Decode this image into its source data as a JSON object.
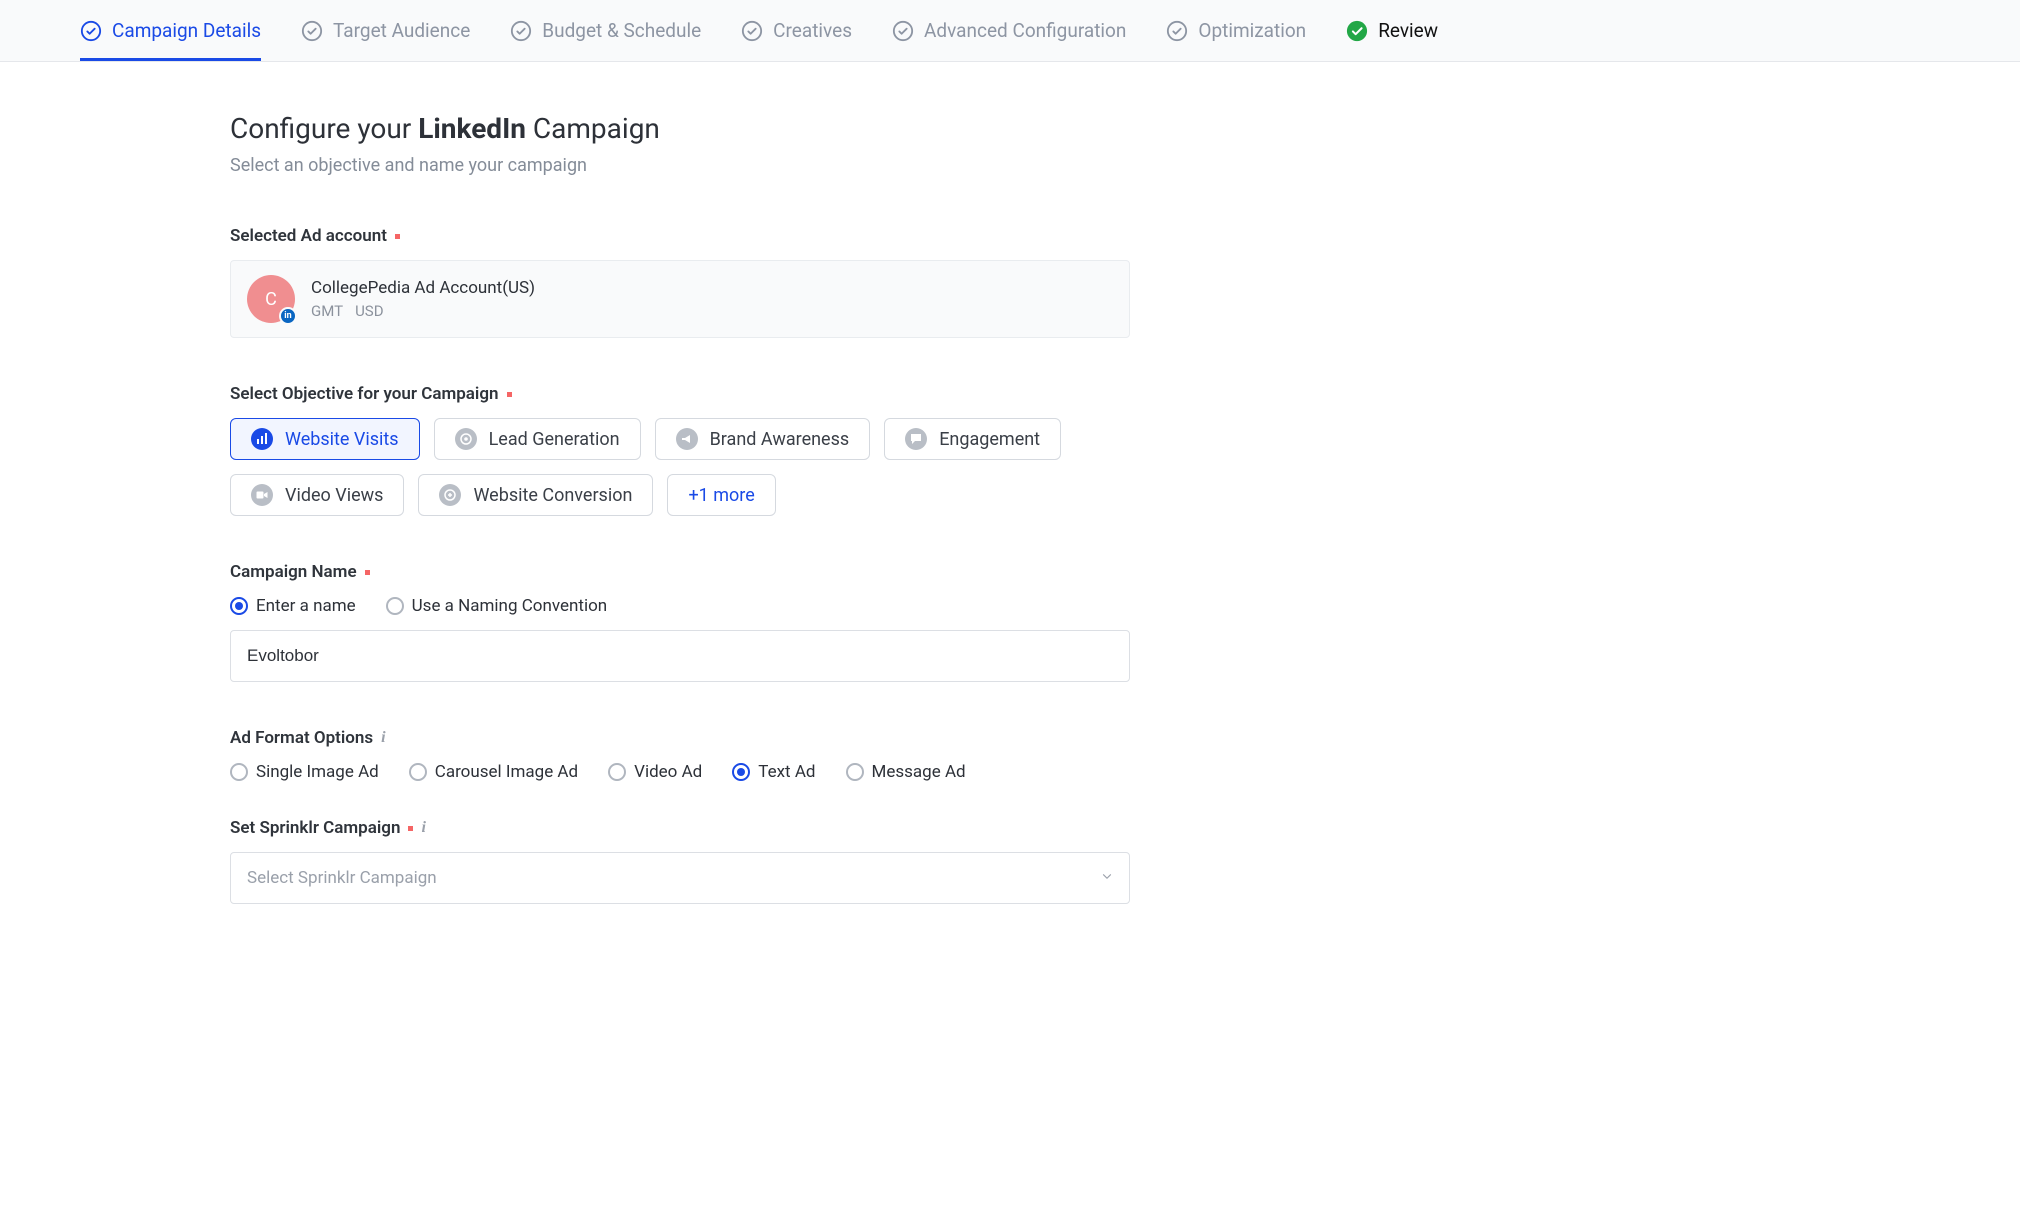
{
  "stepper": {
    "items": [
      {
        "label": "Campaign Details",
        "state": "active"
      },
      {
        "label": "Target Audience",
        "state": "default"
      },
      {
        "label": "Budget & Schedule",
        "state": "default"
      },
      {
        "label": "Creatives",
        "state": "default"
      },
      {
        "label": "Advanced Configuration",
        "state": "default"
      },
      {
        "label": "Optimization",
        "state": "default"
      },
      {
        "label": "Review",
        "state": "done"
      }
    ]
  },
  "header": {
    "title_prefix": "Configure your",
    "title_brand": "LinkedIn",
    "title_suffix": "Campaign",
    "subtitle": "Select an objective and name your campaign"
  },
  "adAccount": {
    "section_label": "Selected Ad account",
    "avatar_letter": "C",
    "badge_text": "in",
    "name": "CollegePedia Ad Account(US)",
    "tz": "GMT",
    "currency": "USD"
  },
  "objective": {
    "section_label": "Select Objective for your Campaign",
    "items": [
      {
        "label": "Website Visits",
        "selected": true
      },
      {
        "label": "Lead Generation",
        "selected": false
      },
      {
        "label": "Brand Awareness",
        "selected": false
      },
      {
        "label": "Engagement",
        "selected": false
      },
      {
        "label": "Video Views",
        "selected": false
      },
      {
        "label": "Website Conversion",
        "selected": false
      }
    ],
    "more_label": "+1 more"
  },
  "campaignName": {
    "section_label": "Campaign Name",
    "options": [
      {
        "label": "Enter a name",
        "checked": true
      },
      {
        "label": "Use a Naming Convention",
        "checked": false
      }
    ],
    "value": "Evoltobor"
  },
  "adFormat": {
    "section_label": "Ad Format Options",
    "options": [
      {
        "label": "Single Image Ad",
        "checked": false
      },
      {
        "label": "Carousel Image Ad",
        "checked": false
      },
      {
        "label": "Video Ad",
        "checked": false
      },
      {
        "label": "Text Ad",
        "checked": true
      },
      {
        "label": "Message Ad",
        "checked": false
      }
    ]
  },
  "sprinklr": {
    "section_label": "Set Sprinklr Campaign",
    "placeholder": "Select Sprinklr Campaign"
  }
}
